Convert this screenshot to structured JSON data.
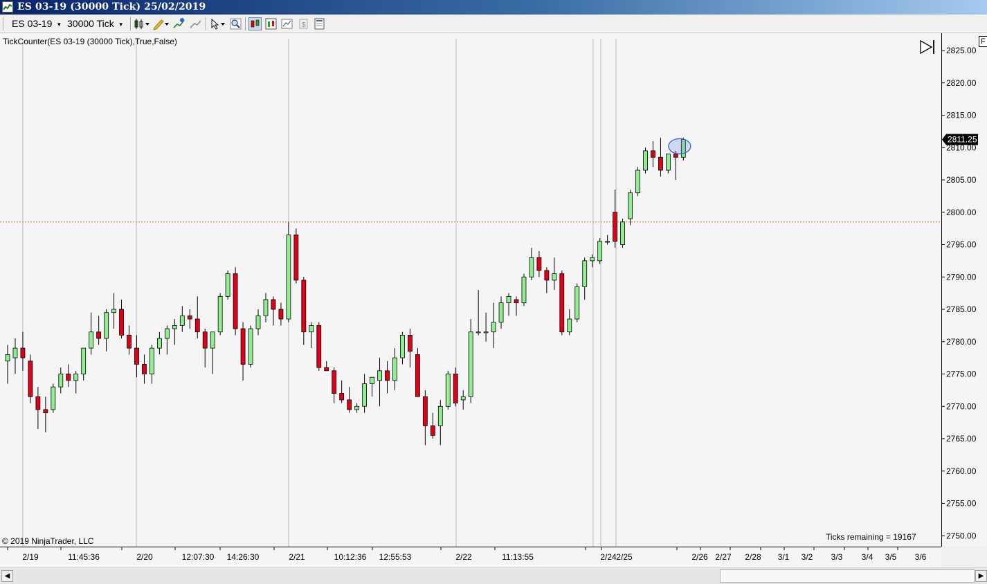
{
  "window": {
    "title": "ES 03-19 (30000 Tick)  25/02/2019"
  },
  "toolbar": {
    "instrument": "ES 03-19",
    "interval": "30000 Tick",
    "icons": [
      "bar-style-icon",
      "drawing-pencil-icon",
      "add-indicator-icon",
      "strategy-icon",
      "cursor-icon",
      "zoom-icon",
      "chart-trader-icon",
      "data-box-icon",
      "properties-icon",
      "snapshot-icon",
      "template-icon"
    ]
  },
  "chart": {
    "indicator_label": "TickCounter(ES  03-19 (30000  Tick),True,False)",
    "copyright": "© 2019 NinjaTrader, LLC",
    "ticks_remaining": "Ticks remaining = 19167",
    "current_price": "2811.25",
    "price_line": 2798.5,
    "colors": {
      "up": "#90ee90",
      "down": "#e0001a",
      "wick": "#000000",
      "price_line": "#e07030",
      "highlight": "#4060d0"
    },
    "price_ticks": [
      "2825.00",
      "2820.00",
      "2815.00",
      "2810.00",
      "2805.00",
      "2800.00",
      "2795.00",
      "2790.00",
      "2785.00",
      "2780.00",
      "2775.00",
      "2770.00",
      "2765.00",
      "2760.00",
      "2755.00",
      "2750.00"
    ],
    "time_labels": [
      "2/19",
      "11:45:36",
      "2/20",
      "12:07:30",
      "14:26:30",
      "2/21",
      "10:12:36",
      "12:55:53",
      "2/22",
      "11:13:55",
      "2/24",
      "2/25",
      "2/26",
      "2/27",
      "2/28",
      "3/1",
      "3/2",
      "3/3",
      "3/4",
      "3/5",
      "3/6"
    ],
    "session_breaks": 7,
    "candles": [
      {
        "o": 2777.0,
        "h": 2779.5,
        "l": 2773.5,
        "c": 2778.0
      },
      {
        "o": 2777.5,
        "h": 2780.5,
        "l": 2775.0,
        "c": 2779.0
      },
      {
        "o": 2779.0,
        "h": 2781.5,
        "l": 2775.5,
        "c": 2777.5
      },
      {
        "o": 2777.0,
        "h": 2778.0,
        "l": 2770.5,
        "c": 2771.5
      },
      {
        "o": 2771.5,
        "h": 2773.0,
        "l": 2766.5,
        "c": 2769.5
      },
      {
        "o": 2769.5,
        "h": 2771.5,
        "l": 2766.0,
        "c": 2769.0
      },
      {
        "o": 2769.5,
        "h": 2773.5,
        "l": 2769.0,
        "c": 2773.0
      },
      {
        "o": 2773.0,
        "h": 2776.0,
        "l": 2772.0,
        "c": 2775.0
      },
      {
        "o": 2775.0,
        "h": 2776.5,
        "l": 2773.0,
        "c": 2774.0
      },
      {
        "o": 2774.0,
        "h": 2775.5,
        "l": 2772.0,
        "c": 2775.0
      },
      {
        "o": 2775.0,
        "h": 2779.0,
        "l": 2774.0,
        "c": 2779.0
      },
      {
        "o": 2779.0,
        "h": 2784.5,
        "l": 2778.0,
        "c": 2781.5
      },
      {
        "o": 2781.5,
        "h": 2784.0,
        "l": 2779.5,
        "c": 2780.5
      },
      {
        "o": 2780.5,
        "h": 2785.0,
        "l": 2778.5,
        "c": 2784.5
      },
      {
        "o": 2784.5,
        "h": 2787.5,
        "l": 2782.0,
        "c": 2785.0
      },
      {
        "o": 2785.0,
        "h": 2786.5,
        "l": 2780.5,
        "c": 2781.0
      },
      {
        "o": 2781.0,
        "h": 2782.5,
        "l": 2778.0,
        "c": 2779.0
      },
      {
        "o": 2779.0,
        "h": 2781.0,
        "l": 2774.5,
        "c": 2776.5
      },
      {
        "o": 2776.5,
        "h": 2778.0,
        "l": 2773.5,
        "c": 2775.0
      },
      {
        "o": 2775.0,
        "h": 2779.5,
        "l": 2773.5,
        "c": 2779.0
      },
      {
        "o": 2779.0,
        "h": 2781.5,
        "l": 2778.0,
        "c": 2780.5
      },
      {
        "o": 2780.5,
        "h": 2782.5,
        "l": 2778.0,
        "c": 2782.0
      },
      {
        "o": 2782.0,
        "h": 2783.5,
        "l": 2779.5,
        "c": 2782.5
      },
      {
        "o": 2782.5,
        "h": 2785.5,
        "l": 2781.5,
        "c": 2784.0
      },
      {
        "o": 2784.0,
        "h": 2785.0,
        "l": 2782.0,
        "c": 2783.5
      },
      {
        "o": 2783.5,
        "h": 2787.0,
        "l": 2780.5,
        "c": 2781.5
      },
      {
        "o": 2781.5,
        "h": 2782.0,
        "l": 2776.0,
        "c": 2779.0
      },
      {
        "o": 2779.0,
        "h": 2781.5,
        "l": 2775.0,
        "c": 2781.5
      },
      {
        "o": 2781.5,
        "h": 2787.5,
        "l": 2781.0,
        "c": 2787.0
      },
      {
        "o": 2787.0,
        "h": 2791.0,
        "l": 2786.5,
        "c": 2790.5
      },
      {
        "o": 2790.5,
        "h": 2791.5,
        "l": 2781.0,
        "c": 2782.0
      },
      {
        "o": 2782.0,
        "h": 2783.0,
        "l": 2774.0,
        "c": 2776.5
      },
      {
        "o": 2776.5,
        "h": 2782.5,
        "l": 2776.0,
        "c": 2782.0
      },
      {
        "o": 2782.0,
        "h": 2785.0,
        "l": 2781.0,
        "c": 2784.0
      },
      {
        "o": 2784.0,
        "h": 2787.5,
        "l": 2783.0,
        "c": 2786.5
      },
      {
        "o": 2786.5,
        "h": 2787.0,
        "l": 2782.5,
        "c": 2785.0
      },
      {
        "o": 2785.0,
        "h": 2786.0,
        "l": 2782.5,
        "c": 2783.5
      },
      {
        "o": 2783.5,
        "h": 2798.5,
        "l": 2783.0,
        "c": 2796.5
      },
      {
        "o": 2796.5,
        "h": 2797.5,
        "l": 2789.0,
        "c": 2789.5
      },
      {
        "o": 2789.5,
        "h": 2790.0,
        "l": 2779.5,
        "c": 2781.5
      },
      {
        "o": 2781.5,
        "h": 2783.0,
        "l": 2779.0,
        "c": 2782.5
      },
      {
        "o": 2782.5,
        "h": 2783.0,
        "l": 2775.5,
        "c": 2776.0
      },
      {
        "o": 2776.0,
        "h": 2777.0,
        "l": 2775.5,
        "c": 2775.5
      },
      {
        "o": 2775.5,
        "h": 2776.0,
        "l": 2770.5,
        "c": 2772.0
      },
      {
        "o": 2772.0,
        "h": 2774.0,
        "l": 2770.5,
        "c": 2771.0
      },
      {
        "o": 2771.0,
        "h": 2773.0,
        "l": 2769.0,
        "c": 2769.5
      },
      {
        "o": 2769.5,
        "h": 2770.5,
        "l": 2769.0,
        "c": 2770.0
      },
      {
        "o": 2770.0,
        "h": 2775.0,
        "l": 2769.0,
        "c": 2773.5
      },
      {
        "o": 2773.5,
        "h": 2774.5,
        "l": 2771.5,
        "c": 2774.5
      },
      {
        "o": 2774.0,
        "h": 2777.5,
        "l": 2770.0,
        "c": 2775.5
      },
      {
        "o": 2775.5,
        "h": 2777.0,
        "l": 2772.0,
        "c": 2774.0
      },
      {
        "o": 2774.0,
        "h": 2779.0,
        "l": 2772.5,
        "c": 2777.5
      },
      {
        "o": 2777.5,
        "h": 2781.5,
        "l": 2776.5,
        "c": 2781.0
      },
      {
        "o": 2781.0,
        "h": 2782.0,
        "l": 2776.0,
        "c": 2778.5
      },
      {
        "o": 2778.0,
        "h": 2779.0,
        "l": 2771.5,
        "c": 2771.5
      },
      {
        "o": 2771.5,
        "h": 2772.5,
        "l": 2764.0,
        "c": 2767.0
      },
      {
        "o": 2767.0,
        "h": 2769.0,
        "l": 2765.0,
        "c": 2765.5
      },
      {
        "o": 2767.0,
        "h": 2771.0,
        "l": 2764.0,
        "c": 2770.0
      },
      {
        "o": 2770.0,
        "h": 2775.5,
        "l": 2769.5,
        "c": 2775.0
      },
      {
        "o": 2775.0,
        "h": 2776.0,
        "l": 2770.0,
        "c": 2770.5
      },
      {
        "o": 2771.0,
        "h": 2772.5,
        "l": 2769.5,
        "c": 2771.5
      },
      {
        "o": 2771.5,
        "h": 2783.5,
        "l": 2770.5,
        "c": 2781.5
      },
      {
        "o": 2781.5,
        "h": 2788.0,
        "l": 2781.0,
        "c": 2781.5
      },
      {
        "o": 2781.5,
        "h": 2784.5,
        "l": 2780.0,
        "c": 2781.5
      },
      {
        "o": 2781.5,
        "h": 2786.0,
        "l": 2779.0,
        "c": 2783.0
      },
      {
        "o": 2783.0,
        "h": 2787.0,
        "l": 2782.0,
        "c": 2786.0
      },
      {
        "o": 2786.0,
        "h": 2787.5,
        "l": 2784.0,
        "c": 2787.0
      },
      {
        "o": 2786.5,
        "h": 2787.0,
        "l": 2784.0,
        "c": 2786.0
      },
      {
        "o": 2786.0,
        "h": 2790.5,
        "l": 2785.5,
        "c": 2790.0
      },
      {
        "o": 2790.0,
        "h": 2794.5,
        "l": 2789.5,
        "c": 2793.0
      },
      {
        "o": 2793.0,
        "h": 2794.0,
        "l": 2790.0,
        "c": 2791.0
      },
      {
        "o": 2791.0,
        "h": 2791.5,
        "l": 2787.5,
        "c": 2789.5
      },
      {
        "o": 2789.5,
        "h": 2793.0,
        "l": 2788.0,
        "c": 2790.5
      },
      {
        "o": 2790.5,
        "h": 2791.0,
        "l": 2781.0,
        "c": 2781.5
      },
      {
        "o": 2781.5,
        "h": 2785.0,
        "l": 2781.0,
        "c": 2783.5
      },
      {
        "o": 2783.5,
        "h": 2789.0,
        "l": 2783.0,
        "c": 2788.5
      },
      {
        "o": 2788.5,
        "h": 2793.0,
        "l": 2786.5,
        "c": 2792.5
      },
      {
        "o": 2792.5,
        "h": 2793.5,
        "l": 2791.5,
        "c": 2793.0
      },
      {
        "o": 2792.5,
        "h": 2796.0,
        "l": 2792.0,
        "c": 2795.5
      },
      {
        "o": 2795.5,
        "h": 2796.5,
        "l": 2795.0,
        "c": 2795.5
      },
      {
        "o": 2800.0,
        "h": 2803.5,
        "l": 2794.5,
        "c": 2795.5
      },
      {
        "o": 2795.0,
        "h": 2799.0,
        "l": 2794.5,
        "c": 2798.5
      },
      {
        "o": 2799.0,
        "h": 2803.5,
        "l": 2798.0,
        "c": 2803.0
      },
      {
        "o": 2803.0,
        "h": 2807.0,
        "l": 2802.5,
        "c": 2806.5
      },
      {
        "o": 2806.5,
        "h": 2810.0,
        "l": 2806.0,
        "c": 2809.5
      },
      {
        "o": 2809.5,
        "h": 2811.0,
        "l": 2807.0,
        "c": 2808.5
      },
      {
        "o": 2808.5,
        "h": 2811.5,
        "l": 2805.5,
        "c": 2806.5
      },
      {
        "o": 2806.5,
        "h": 2809.0,
        "l": 2806.0,
        "c": 2809.0
      },
      {
        "o": 2809.0,
        "h": 2809.5,
        "l": 2805.0,
        "c": 2808.5
      },
      {
        "o": 2808.5,
        "h": 2811.5,
        "l": 2808.0,
        "c": 2811.25
      }
    ]
  }
}
